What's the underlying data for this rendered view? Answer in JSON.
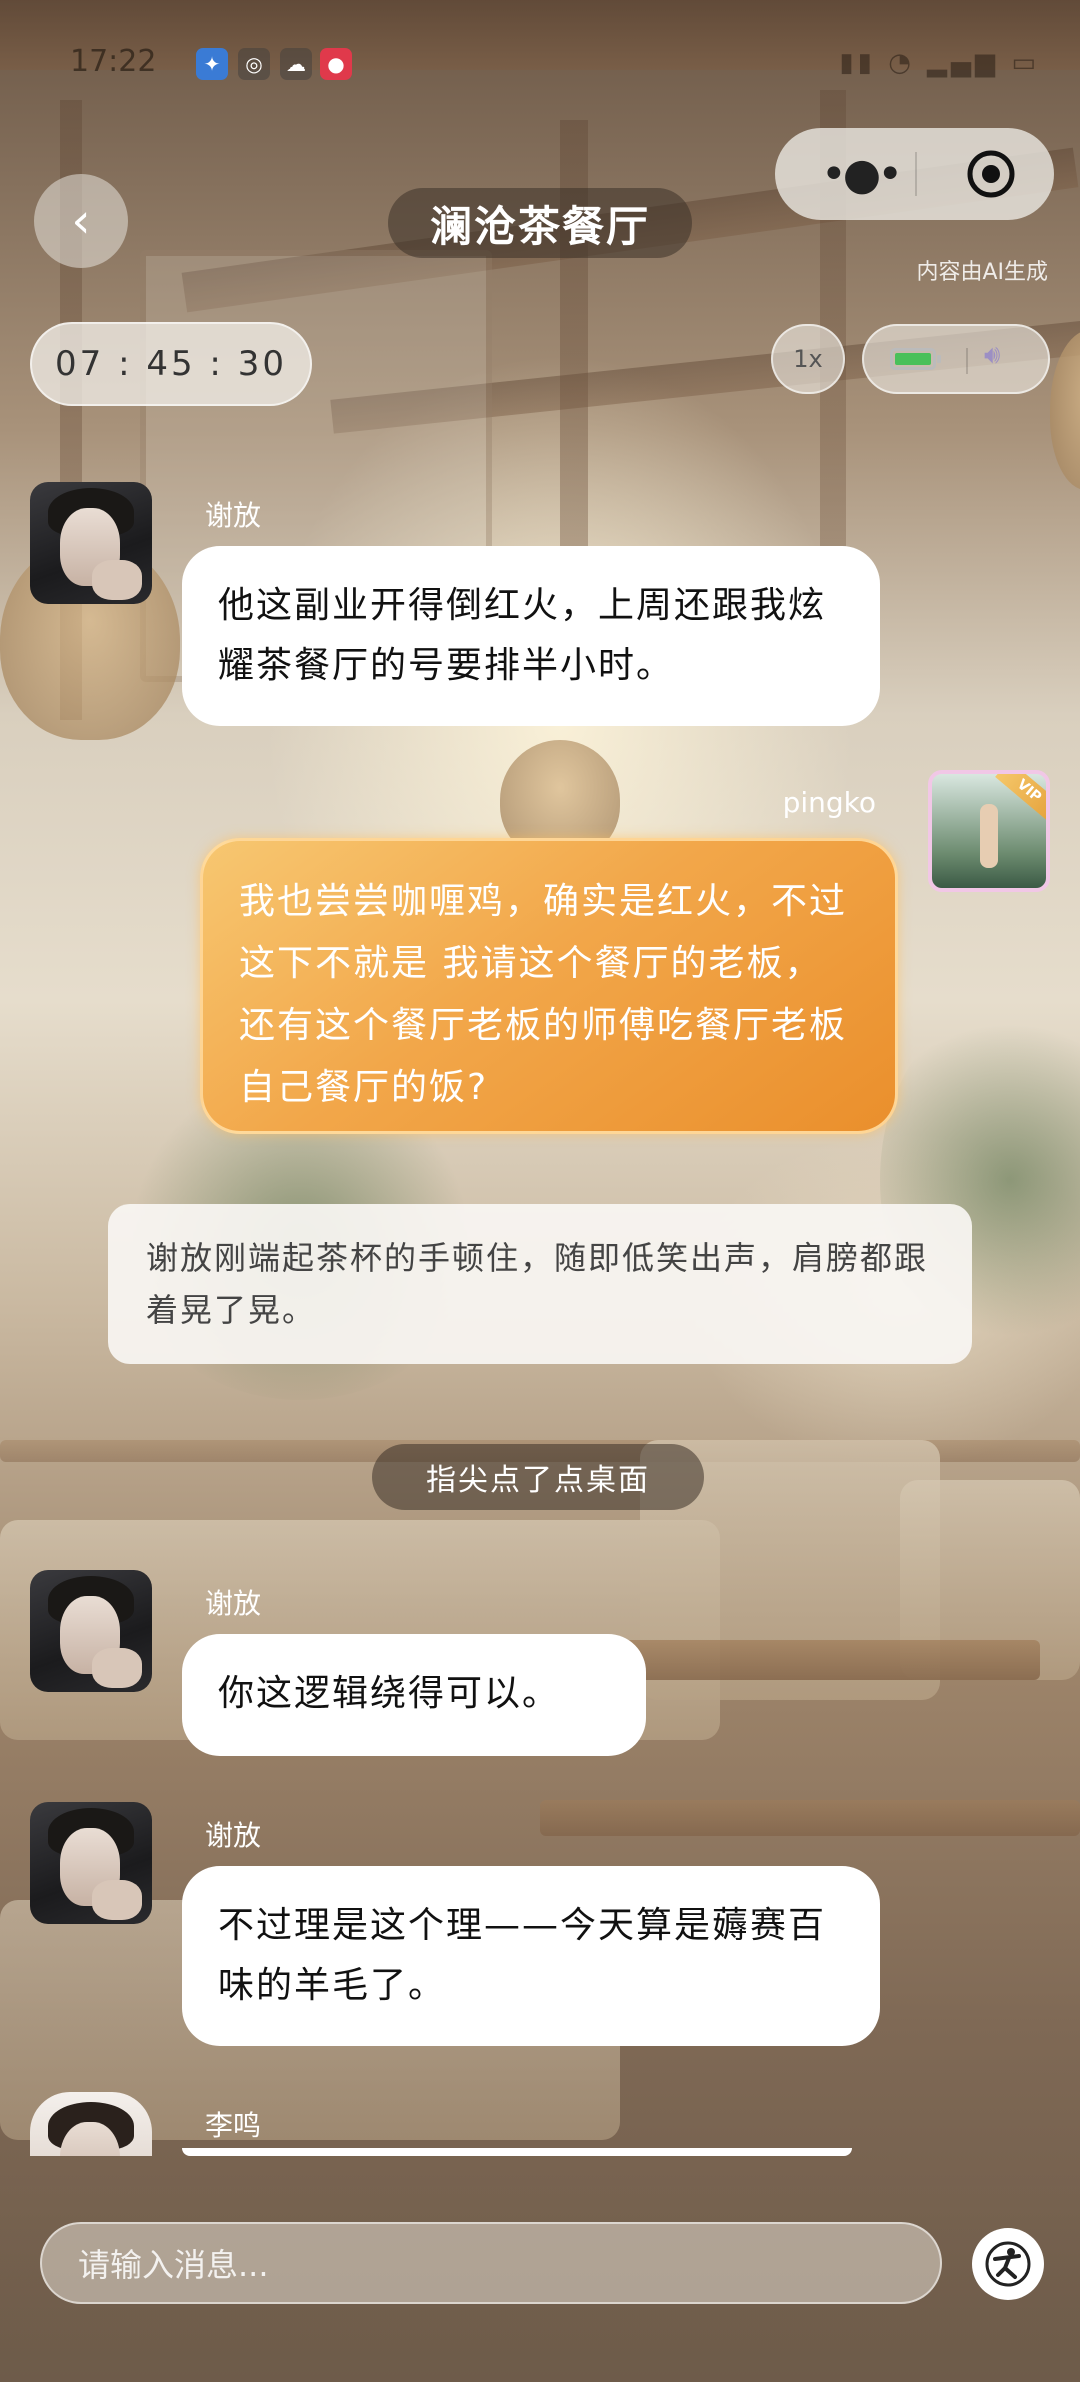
{
  "status_bar": {
    "time": "17:22"
  },
  "header": {
    "title": "澜沧茶餐厅",
    "ai_note": "内容由AI生成",
    "timer": "07 : 45 : 30",
    "speed": "1x"
  },
  "messages": [
    {
      "sender": "谢放",
      "text": "他这副业开得倒红火，上周还跟我炫耀茶餐厅的号要排半小时。"
    },
    {
      "sender": "pingko",
      "text": "我也尝尝咖喱鸡，确实是红火，不过这下不就是 我请这个餐厅的老板，还有这个餐厅老板的师傅吃餐厅老板自己餐厅的饭?"
    },
    {
      "narration": "谢放刚端起茶杯的手顿住，随即低笑出声，肩膀都跟着晃了晃。"
    },
    {
      "action": "指尖点了点桌面"
    },
    {
      "sender": "谢放",
      "text": "你这逻辑绕得可以。"
    },
    {
      "sender": "谢放",
      "text": "不过理是这个理——今天算是薅赛百味的羊毛了。"
    },
    {
      "sender": "李鸣"
    }
  ],
  "input": {
    "placeholder": "请输入消息..."
  },
  "icons": {
    "back": "chevron-left-icon",
    "more": "more-dots-icon",
    "close": "target-circle-icon",
    "battery": "battery-icon",
    "sound": "speaker-icon",
    "assist": "accessibility-icon"
  },
  "colors": {
    "my_bubble": "#f2a74a",
    "bubble": "#ffffff",
    "battery": "#49c05a"
  }
}
